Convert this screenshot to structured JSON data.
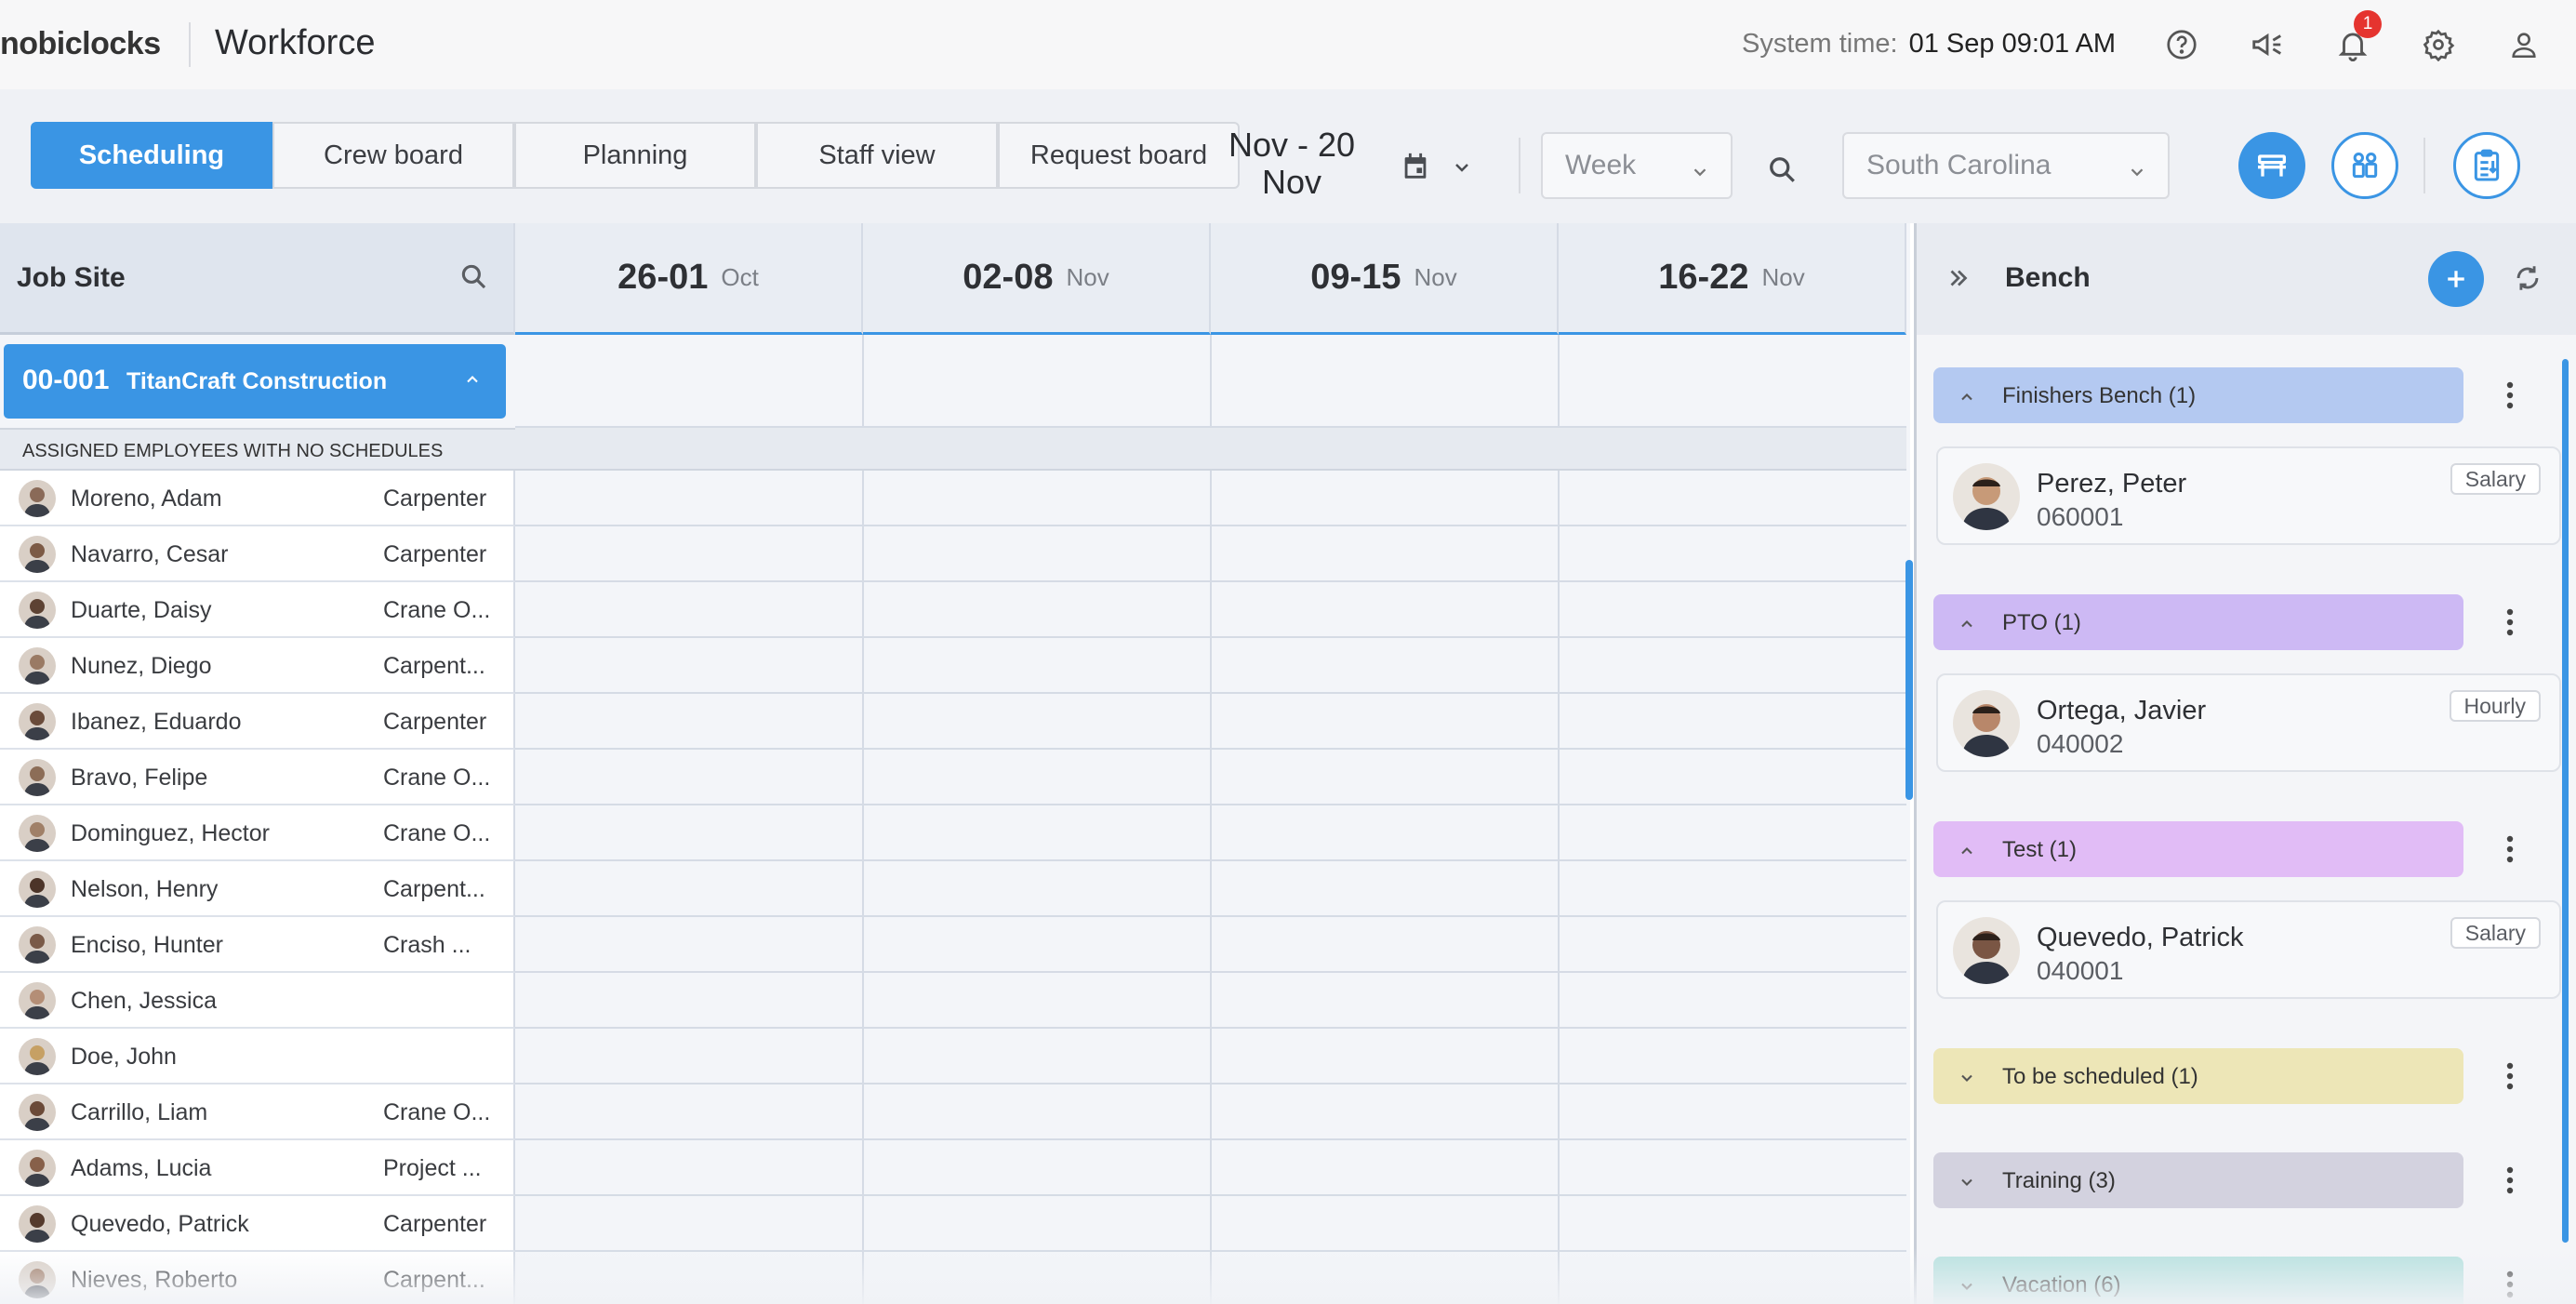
{
  "header": {
    "brand": "nobiclocks",
    "app_title": "Workforce",
    "system_time_label": "System time:",
    "system_time_value": "01 Sep 09:01 AM",
    "notification_count": "1"
  },
  "tabs": [
    "Scheduling",
    "Crew board",
    "Planning",
    "Staff view",
    "Request board"
  ],
  "toolbar": {
    "date_range_line1": "Nov - 20",
    "date_range_line2": "Nov",
    "view_select": "Week",
    "location_select": "South Carolina"
  },
  "grid": {
    "job_site_label": "Job Site",
    "weeks": [
      {
        "days": "26-01",
        "month": "Oct"
      },
      {
        "days": "02-08",
        "month": "Nov"
      },
      {
        "days": "09-15",
        "month": "Nov"
      },
      {
        "days": "16-22",
        "month": "Nov"
      }
    ],
    "site": {
      "code": "00-001",
      "name": "TitanCraft Construction"
    },
    "assigned_label": "ASSIGNED EMPLOYEES WITH NO SCHEDULES",
    "employees": [
      {
        "name": "Moreno, Adam",
        "role": "Carpenter"
      },
      {
        "name": "Navarro, Cesar",
        "role": "Carpenter"
      },
      {
        "name": "Duarte, Daisy",
        "role": "Crane O..."
      },
      {
        "name": "Nunez, Diego",
        "role": "Carpent..."
      },
      {
        "name": "Ibanez, Eduardo",
        "role": "Carpenter"
      },
      {
        "name": "Bravo, Felipe",
        "role": "Crane O..."
      },
      {
        "name": "Dominguez, Hector",
        "role": "Crane O..."
      },
      {
        "name": "Nelson, Henry",
        "role": "Carpent..."
      },
      {
        "name": "Enciso, Hunter",
        "role": "Crash ..."
      },
      {
        "name": "Chen, Jessica",
        "role": ""
      },
      {
        "name": "Doe, John",
        "role": ""
      },
      {
        "name": "Carrillo, Liam",
        "role": "Crane O..."
      },
      {
        "name": "Adams, Lucia",
        "role": "Project ..."
      },
      {
        "name": "Quevedo, Patrick",
        "role": "Carpenter"
      },
      {
        "name": "Nieves, Roberto",
        "role": "Carpent..."
      }
    ]
  },
  "bench": {
    "title": "Bench",
    "groups": [
      {
        "label": "Finishers Bench (1)",
        "color": "#b4c9f1",
        "expanded": true,
        "employee": {
          "name": "Perez, Peter",
          "id": "060001",
          "pay": "Salary"
        }
      },
      {
        "label": "PTO (1)",
        "color": "#cdb9f4",
        "expanded": true,
        "employee": {
          "name": "Ortega, Javier",
          "id": "040002",
          "pay": "Hourly"
        }
      },
      {
        "label": "Test (1)",
        "color": "#e1bcf6",
        "expanded": true,
        "employee": {
          "name": "Quevedo, Patrick",
          "id": "040001",
          "pay": "Salary"
        }
      },
      {
        "label": "To be scheduled (1)",
        "color": "#ede6b7",
        "expanded": false
      },
      {
        "label": "Training (3)",
        "color": "#d3d2df",
        "expanded": false
      },
      {
        "label": "Vacation (6)",
        "color": "#b7e1df",
        "expanded": false
      }
    ]
  },
  "colors": {
    "accent": "#3a95e4",
    "badge": "#e5342f"
  }
}
